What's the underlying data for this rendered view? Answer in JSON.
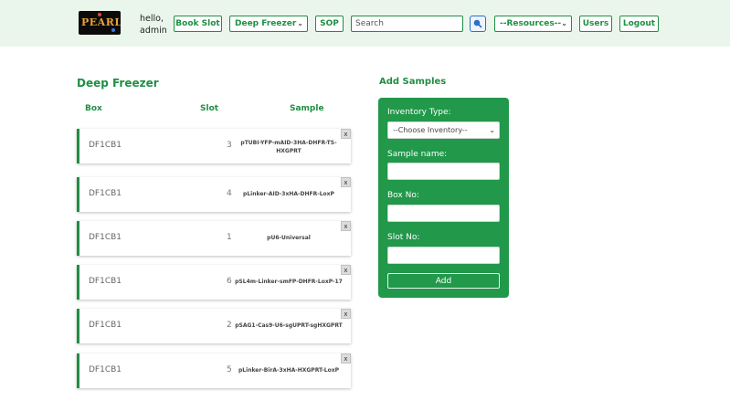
{
  "navbar": {
    "logo_text": "PEARL",
    "greeting_line1": "hello,",
    "greeting_line2": "admin",
    "book_slot": "Book Slot",
    "deep_freezer": "Deep Freezer",
    "sop": "SOP",
    "search_placeholder": "Search",
    "resources": "--Resources--",
    "users": "Users",
    "logout": "Logout"
  },
  "inventory": {
    "title": "Deep Freezer",
    "columns": {
      "box": "Box",
      "slot": "Slot",
      "sample": "Sample"
    },
    "rows": [
      {
        "box": "DF1CB1",
        "slot": "3",
        "sample": "pTUBI-YFP-mAID-3HA-DHFR-TS-HXGPRT",
        "remove": "x"
      },
      {
        "box": "DF1CB1",
        "slot": "4",
        "sample": "pLinker-AID-3xHA-DHFR-LoxP",
        "remove": "x"
      },
      {
        "box": "DF1CB1",
        "slot": "1",
        "sample": "pU6-Universal",
        "remove": "x"
      },
      {
        "box": "DF1CB1",
        "slot": "6",
        "sample": "pSL4m-Linker-smFP-DHFR-LoxP-17",
        "remove": "x"
      },
      {
        "box": "DF1CB1",
        "slot": "2",
        "sample": "pSAG1-Cas9-U6-sgUPRT-sgHXGPRT",
        "remove": "x"
      },
      {
        "box": "DF1CB1",
        "slot": "5",
        "sample": "pLinker-BirA-3xHA-HXGPRT-LoxP",
        "remove": "x"
      }
    ]
  },
  "add_samples": {
    "title": "Add Samples",
    "inventory_type_label": "Inventory Type:",
    "inventory_type_value": "--Choose Inventory--",
    "sample_name_label": "Sample name:",
    "box_no_label": "Box No:",
    "slot_no_label": "Slot No:",
    "add_button": "Add"
  },
  "colors": {
    "accent": "#1f8f43",
    "form_background": "#21984a",
    "navbar_background": "#eaf6ec"
  },
  "icons": [
    "search-icon",
    "chevron-down-icon",
    "close-icon"
  ]
}
